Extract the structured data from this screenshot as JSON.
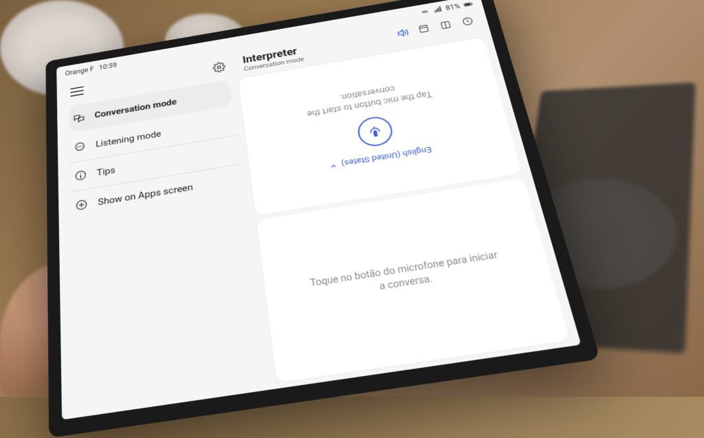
{
  "statusbar": {
    "carrier": "Orange F",
    "time": "10:59",
    "battery": "81%"
  },
  "app": {
    "title": "Interpreter",
    "subtitle": "Conversation mode"
  },
  "menu": {
    "items": [
      {
        "label": "Conversation mode",
        "icon": "chat-translate"
      },
      {
        "label": "Listening mode",
        "icon": "comment"
      },
      {
        "label": "Tips",
        "icon": "info"
      },
      {
        "label": "Show on Apps screen",
        "icon": "plus"
      }
    ]
  },
  "conversation": {
    "top": {
      "language": "English (United States)",
      "hint": "Tap the mic button to start the conversation."
    },
    "bottom": {
      "hint": "Toque no botão do microfone para iniciar a conversa."
    }
  },
  "colors": {
    "accent": "#3b5fe0"
  }
}
